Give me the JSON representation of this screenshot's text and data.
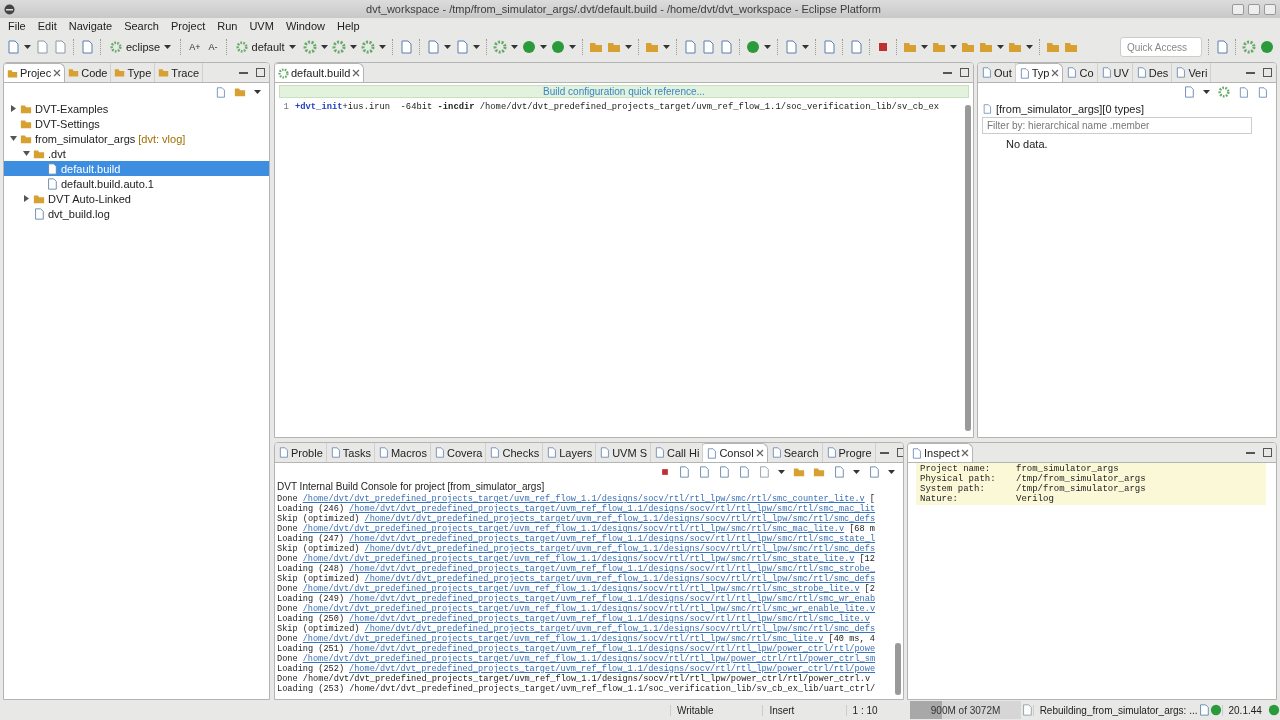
{
  "window": {
    "title": "dvt_workspace - /tmp/from_simulator_args/.dvt/default.build - /home/dvt/dvt_workspace - Eclipse Platform"
  },
  "menu": [
    "File",
    "Edit",
    "Navigate",
    "Search",
    "Project",
    "Run",
    "UVM",
    "Window",
    "Help"
  ],
  "toolbar": {
    "perspective": "eclipse",
    "font_buttons": [
      "A+",
      "A-"
    ],
    "config": "default",
    "quick_access": {
      "placeholder": "Quick Access"
    }
  },
  "left_panel": {
    "tabs": [
      {
        "label": "Projec",
        "selected": true
      },
      {
        "label": "Code",
        "selected": false
      },
      {
        "label": "Type",
        "selected": false
      },
      {
        "label": "Trace",
        "selected": false
      }
    ],
    "tree": [
      {
        "label": "DVT-Examples",
        "expanded": false,
        "selected": false
      },
      {
        "label": "DVT-Settings",
        "selected": false
      },
      {
        "label": "from_simulator_args",
        "decoration": "[dvt: vlog]",
        "expanded": true,
        "selected": false,
        "children": [
          {
            "label": ".dvt",
            "expanded": true,
            "selected": false,
            "children": [
              {
                "label": "default.build",
                "selected": true
              },
              {
                "label": "default.build.auto.1",
                "selected": false
              }
            ]
          },
          {
            "label": "DVT Auto-Linked",
            "expanded": false,
            "selected": false
          },
          {
            "label": "dvt_build.log",
            "selected": false
          }
        ]
      }
    ]
  },
  "editor": {
    "tabs": [
      {
        "label": "default.build",
        "selected": true
      }
    ],
    "banner": "Build configuration quick reference...",
    "lines": [
      {
        "number": "1",
        "tokens": [
          {
            "kind": "directive",
            "text": "+dvt_init"
          },
          {
            "kind": "plain",
            "text": "+ius.irun  -64bit "
          },
          {
            "kind": "option",
            "text": "-incdir"
          },
          {
            "kind": "plain",
            "text": " /home/dvt/dvt_predefined_projects_target/uvm_ref_flow_1.1/soc_verification_lib/sv_cb_ex"
          }
        ]
      }
    ]
  },
  "types_panel": {
    "tabs": [
      {
        "label": "Out",
        "selected": false
      },
      {
        "label": "Typ",
        "selected": true
      },
      {
        "label": "Co",
        "selected": false
      },
      {
        "label": "UV",
        "selected": false
      },
      {
        "label": "Des",
        "selected": false
      },
      {
        "label": "Veri",
        "selected": false
      }
    ],
    "header": "[from_simulator_args][0 types]",
    "filter": {
      "placeholder": "Filter by: hierarchical name .member"
    },
    "message": "No data."
  },
  "bottom_panel": {
    "tabs": [
      {
        "label": "Proble",
        "selected": false
      },
      {
        "label": "Tasks",
        "selected": false
      },
      {
        "label": "Macros",
        "selected": false
      },
      {
        "label": "Covera",
        "selected": false
      },
      {
        "label": "Checks",
        "selected": false
      },
      {
        "label": "Layers",
        "selected": false
      },
      {
        "label": "UVM S",
        "selected": false
      },
      {
        "label": "Call Hi",
        "selected": false
      },
      {
        "label": "Consol",
        "selected": true
      },
      {
        "label": "Search",
        "selected": false
      },
      {
        "label": "Progre",
        "selected": false
      }
    ],
    "console_title": "DVT Internal Build Console for project [from_simulator_args]",
    "lines": [
      {
        "kind": "link",
        "prefix": "Done",
        "link": "/home/dvt/dvt_predefined_projects_target/uvm_ref_flow_1.1/designs/socv/rtl/rtl_lpw/smc/rtl/smc_counter_lite.v",
        "suffix": "["
      },
      {
        "kind": "link",
        "prefix": "Loading (246)",
        "link": "/home/dvt/dvt_predefined_projects_target/uvm_ref_flow_1.1/designs/socv/rtl/rtl_lpw/smc/rtl/smc_mac_lit"
      },
      {
        "kind": "link",
        "prefix": "Skip (optimized)",
        "link": "/home/dvt/dvt_predefined_projects_target/uvm_ref_flow_1.1/designs/socv/rtl/rtl_lpw/smc/rtl/smc_defs"
      },
      {
        "kind": "link",
        "prefix": "Done",
        "link": "/home/dvt/dvt_predefined_projects_target/uvm_ref_flow_1.1/designs/socv/rtl/rtl_lpw/smc/rtl/smc_mac_lite.v",
        "suffix": "[68 m"
      },
      {
        "kind": "link",
        "prefix": "Loading (247)",
        "link": "/home/dvt/dvt_predefined_projects_target/uvm_ref_flow_1.1/designs/socv/rtl/rtl_lpw/smc/rtl/smc_state_l"
      },
      {
        "kind": "link",
        "prefix": "Skip (optimized)",
        "link": "/home/dvt/dvt_predefined_projects_target/uvm_ref_flow_1.1/designs/socv/rtl/rtl_lpw/smc/rtl/smc_defs"
      },
      {
        "kind": "link",
        "prefix": "Done",
        "link": "/home/dvt/dvt_predefined_projects_target/uvm_ref_flow_1.1/designs/socv/rtl/rtl_lpw/smc/rtl/smc_state_lite.v",
        "suffix": "[12"
      },
      {
        "kind": "link",
        "prefix": "Loading (248)",
        "link": "/home/dvt/dvt_predefined_projects_target/uvm_ref_flow_1.1/designs/socv/rtl/rtl_lpw/smc/rtl/smc_strobe_"
      },
      {
        "kind": "link",
        "prefix": "Skip (optimized)",
        "link": "/home/dvt/dvt_predefined_projects_target/uvm_ref_flow_1.1/designs/socv/rtl/rtl_lpw/smc/rtl/smc_defs"
      },
      {
        "kind": "link",
        "prefix": "Done",
        "link": "/home/dvt/dvt_predefined_projects_target/uvm_ref_flow_1.1/designs/socv/rtl/rtl_lpw/smc/rtl/smc_strobe_lite.v",
        "suffix": "[2"
      },
      {
        "kind": "link",
        "prefix": "Loading (249)",
        "link": "/home/dvt/dvt_predefined_projects_target/uvm_ref_flow_1.1/designs/socv/rtl/rtl_lpw/smc/rtl/smc_wr_enab"
      },
      {
        "kind": "link",
        "prefix": "Done",
        "link": "/home/dvt/dvt_predefined_projects_target/uvm_ref_flow_1.1/designs/socv/rtl/rtl_lpw/smc/rtl/smc_wr_enable_lite.v"
      },
      {
        "kind": "link",
        "prefix": "Loading (250)",
        "link": "/home/dvt/dvt_predefined_projects_target/uvm_ref_flow_1.1/designs/socv/rtl/rtl_lpw/smc/rtl/smc_lite.v"
      },
      {
        "kind": "link",
        "prefix": "Skip (optimized)",
        "link": "/home/dvt/dvt_predefined_projects_target/uvm_ref_flow_1.1/designs/socv/rtl/rtl_lpw/smc/rtl/smc_defs"
      },
      {
        "kind": "link",
        "prefix": "Done",
        "link": "/home/dvt/dvt_predefined_projects_target/uvm_ref_flow_1.1/designs/socv/rtl/rtl_lpw/smc/rtl/smc_lite.v",
        "suffix": "[40 ms, 4"
      },
      {
        "kind": "link",
        "prefix": "Loading (251)",
        "link": "/home/dvt/dvt_predefined_projects_target/uvm_ref_flow_1.1/designs/socv/rtl/rtl_lpw/power_ctrl/rtl/powe"
      },
      {
        "kind": "link",
        "prefix": "Done",
        "link": "/home/dvt/dvt_predefined_projects_target/uvm_ref_flow_1.1/designs/socv/rtl/rtl_lpw/power_ctrl/rtl/power_ctrl_sm"
      },
      {
        "kind": "link",
        "prefix": "Loading (252)",
        "link": "/home/dvt/dvt_predefined_projects_target/uvm_ref_flow_1.1/designs/socv/rtl/rtl_lpw/power_ctrl/rtl/powe"
      },
      {
        "kind": "plain",
        "text": "Done /home/dvt/dvt_predefined_projects_target/uvm_ref_flow_1.1/designs/socv/rtl/rtl_lpw/power_ctrl/rtl/power_ctrl.v"
      },
      {
        "kind": "plain",
        "text": "Loading (253) /home/dvt/dvt_predefined_projects_target/uvm_ref_flow_1.1/soc_verification_lib/sv_cb_ex_lib/uart_ctrl/"
      }
    ]
  },
  "inspect_panel": {
    "tabs": [
      {
        "label": "Inspect",
        "selected": true
      }
    ],
    "rows": [
      {
        "label": "Project name:",
        "value": "from_simulator_args"
      },
      {
        "label": "Physical path:",
        "value": "/tmp/from_simulator_args"
      },
      {
        "label": "System path:",
        "value": "/tmp/from_simulator_args"
      },
      {
        "label": "Nature:",
        "value": "Verilog"
      }
    ]
  },
  "status_bar": {
    "mode": "Writable",
    "insert": "Insert",
    "position": "1 : 10",
    "heap": {
      "text": "900M of 3072M",
      "level": 0.29
    },
    "job": "Rebuilding_from_simulator_args: ...",
    "version": "20.1.44"
  }
}
